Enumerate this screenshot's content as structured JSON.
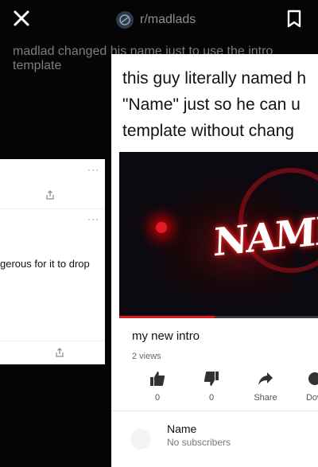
{
  "topbar": {
    "close_icon": "close-icon",
    "subreddit": "r/madlads",
    "subreddit_icon": "subreddit-icon",
    "bookmark_icon": "bookmark-icon"
  },
  "post": {
    "title": "madlad changed his name just to use the intro template"
  },
  "left_card": {
    "text": "gerous for it to drop"
  },
  "meme": {
    "caption": "this guy literally named h\n\"Name\" just so he can u\ntemplate without chang",
    "logo_text": "NAME",
    "video_title": "my new intro",
    "views": "2 views",
    "progress_fraction": 0.48,
    "actions": [
      {
        "icon": "thumbs-up-icon",
        "label": "0"
      },
      {
        "icon": "thumbs-down-icon",
        "label": "0"
      },
      {
        "icon": "share-icon",
        "label": "Share"
      },
      {
        "icon": "download-icon",
        "label": "Dow"
      }
    ],
    "channel": {
      "name": "Name",
      "subs": "No subscribers"
    }
  },
  "colors": {
    "background": "#050505",
    "accent_red": "#e01a1a",
    "muted_text": "#7a7e84"
  }
}
